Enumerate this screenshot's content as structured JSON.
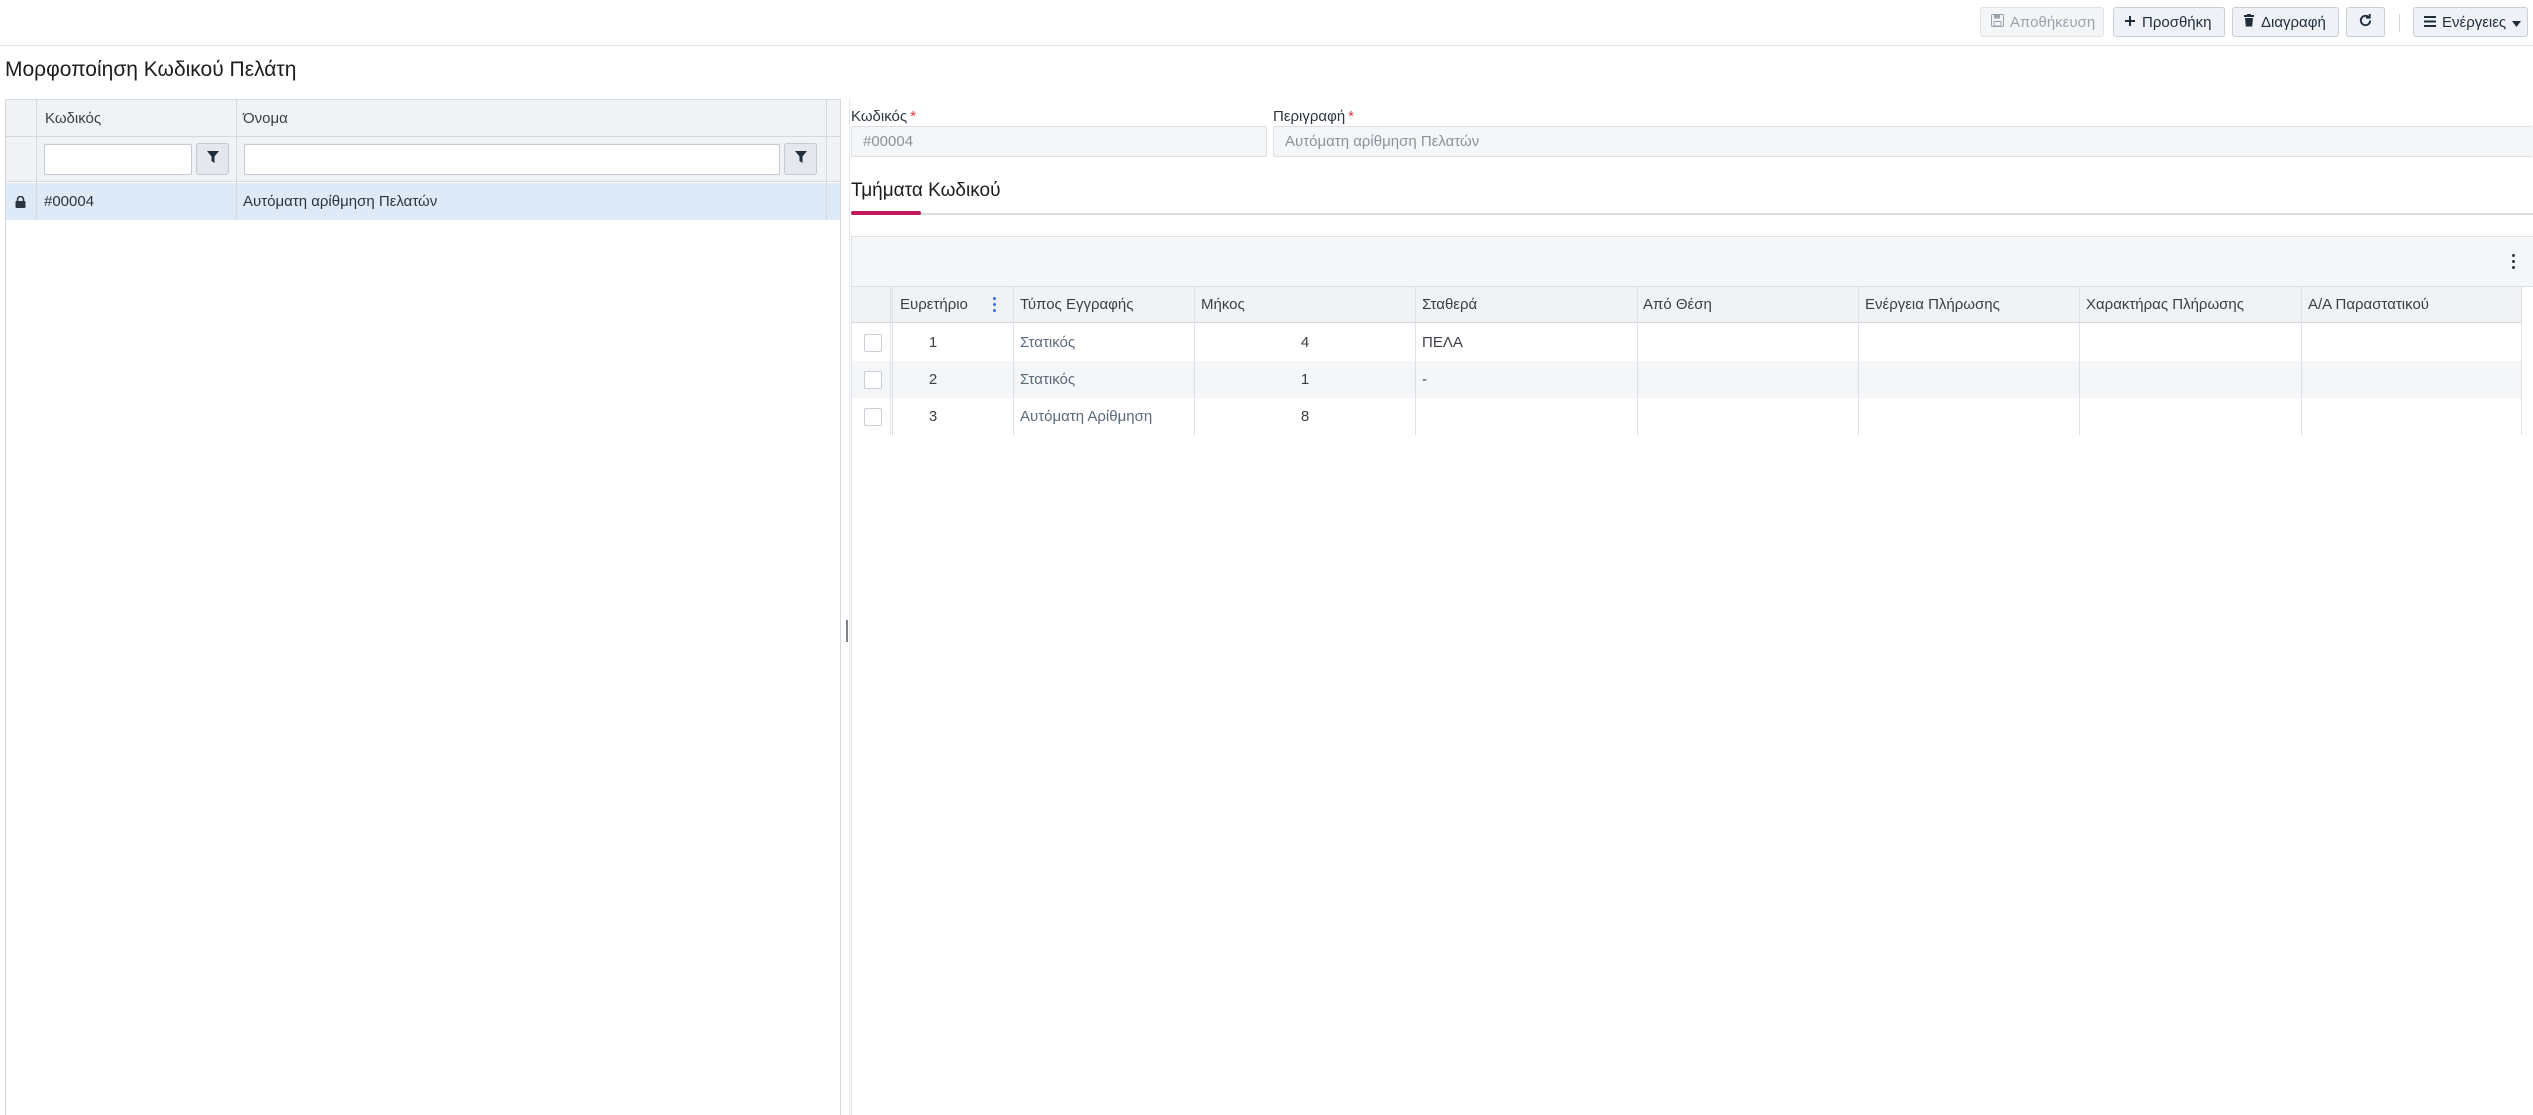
{
  "toolbar": {
    "save_label": "Αποθήκευση",
    "add_label": "Προσθήκη",
    "delete_label": "Διαγραφή",
    "actions_label": "Ενέργειες"
  },
  "page": {
    "title": "Μορφοποίηση Κωδικού Πελάτη"
  },
  "left_grid": {
    "columns": [
      "Κωδικός",
      "Όνομα"
    ],
    "rows": [
      {
        "code": "#00004",
        "name": "Αυτόματη αρίθμηση Πελατών"
      }
    ]
  },
  "form": {
    "code_label": "Κωδικός",
    "code_value": "#00004",
    "description_label": "Περιγραφή",
    "description_value": "Αυτόματη αρίθμηση Πελατών",
    "required_mark": "*"
  },
  "tabs": [
    {
      "label": "Τμήματα Κωδικού",
      "active": true
    }
  ],
  "segments_grid": {
    "columns": [
      "Ευρετήριο",
      "Τύπος Εγγραφής",
      "Μήκος",
      "Σταθερά",
      "Από Θέση",
      "Ενέργεια Πλήρωσης",
      "Χαρακτήρας Πλήρωσης",
      "Α/Α Παραστατικού"
    ],
    "rows": [
      {
        "index": "1",
        "type": "Στατικός",
        "length": "4",
        "constant": "ΠΕΛΑ"
      },
      {
        "index": "2",
        "type": "Στατικός",
        "length": "1",
        "constant": "-"
      },
      {
        "index": "3",
        "type": "Αυτόματη Αρίθμηση",
        "length": "8",
        "constant": ""
      }
    ]
  },
  "colors": {
    "accent_tab": "#c2185b",
    "selected_row": "#dfeaf8",
    "required": "#d63a3a"
  },
  "icons": {
    "save": "floppy-icon",
    "add": "plus-icon",
    "delete": "trash-icon",
    "refresh": "refresh-icon",
    "actions": "menu-icon",
    "filter": "filter-icon",
    "lock": "lock-icon",
    "more": "kebab-icon"
  }
}
